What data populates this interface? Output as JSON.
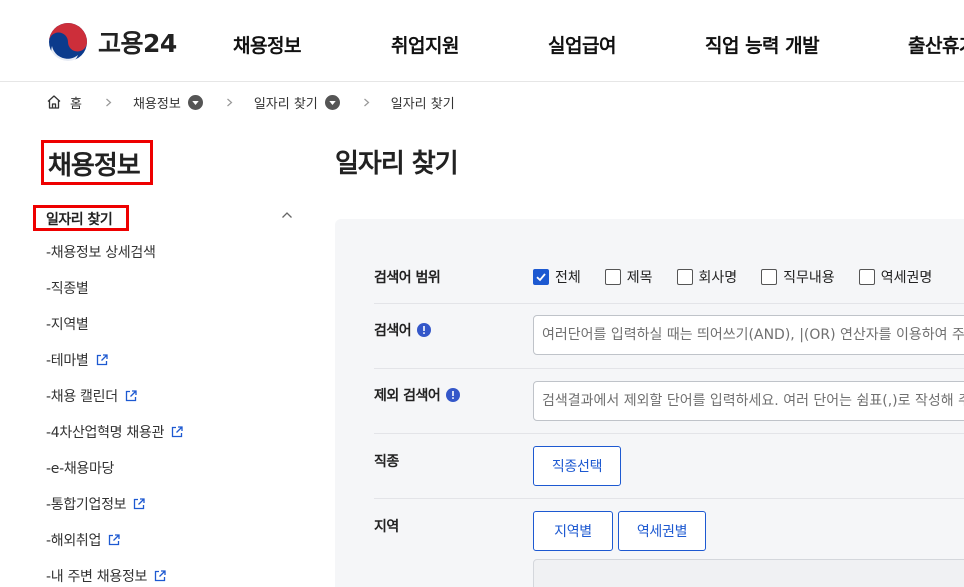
{
  "header": {
    "logo_text": "고용24",
    "nav": [
      "채용정보",
      "취업지원",
      "실업급여",
      "직업 능력 개발",
      "출산휴가"
    ]
  },
  "breadcrumb": {
    "home": "홈",
    "level1": "채용정보",
    "level2": "일자리 찾기",
    "current": "일자리 찾기"
  },
  "sidebar": {
    "title": "채용정보",
    "current_section": "일자리 찾기",
    "items": [
      {
        "label": "-채용정보 상세검색"
      },
      {
        "label": "-직종별"
      },
      {
        "label": "-지역별"
      },
      {
        "label": "-테마별"
      },
      {
        "label": "-채용 캘린더"
      },
      {
        "label": "-4차산업혁명 채용관"
      },
      {
        "label": "-e-채용마당"
      },
      {
        "label": "-통합기업정보"
      },
      {
        "label": "-해외취업"
      },
      {
        "label": "-내 주변 채용정보"
      }
    ]
  },
  "main": {
    "page_title": "일자리 찾기",
    "search_form": {
      "scope_label": "검색어 범위",
      "scope_options": [
        {
          "label": "전체",
          "checked": true
        },
        {
          "label": "제목",
          "checked": false
        },
        {
          "label": "회사명",
          "checked": false
        },
        {
          "label": "직무내용",
          "checked": false
        },
        {
          "label": "역세권명",
          "checked": false
        }
      ],
      "keyword_label": "검색어",
      "keyword_placeholder": "여러단어를 입력하실 때는 띄어쓰기(AND), |(OR) 연산자를 이용하여 주세요.",
      "keyword_value": "",
      "exclude_label": "제외 검색어",
      "exclude_placeholder": "검색결과에서 제외할 단어를 입력하세요. 여러 단어는 쉼표(,)로 작성해 주세요.",
      "exclude_value": "",
      "job_label": "직종",
      "job_button": "직종선택",
      "region_label": "지역",
      "region_button": "지역별",
      "station_button": "역세권별"
    }
  },
  "colors": {
    "accent": "#1d59d1",
    "highlight_box": "#ee0000",
    "panel_bg": "#f5f6f8"
  },
  "icons": [
    "government-logo-icon",
    "home-icon",
    "chevron-right-icon",
    "dropdown-circle-icon",
    "chevron-up-icon",
    "external-link-icon",
    "info-circle-icon",
    "checkmark-icon"
  ]
}
